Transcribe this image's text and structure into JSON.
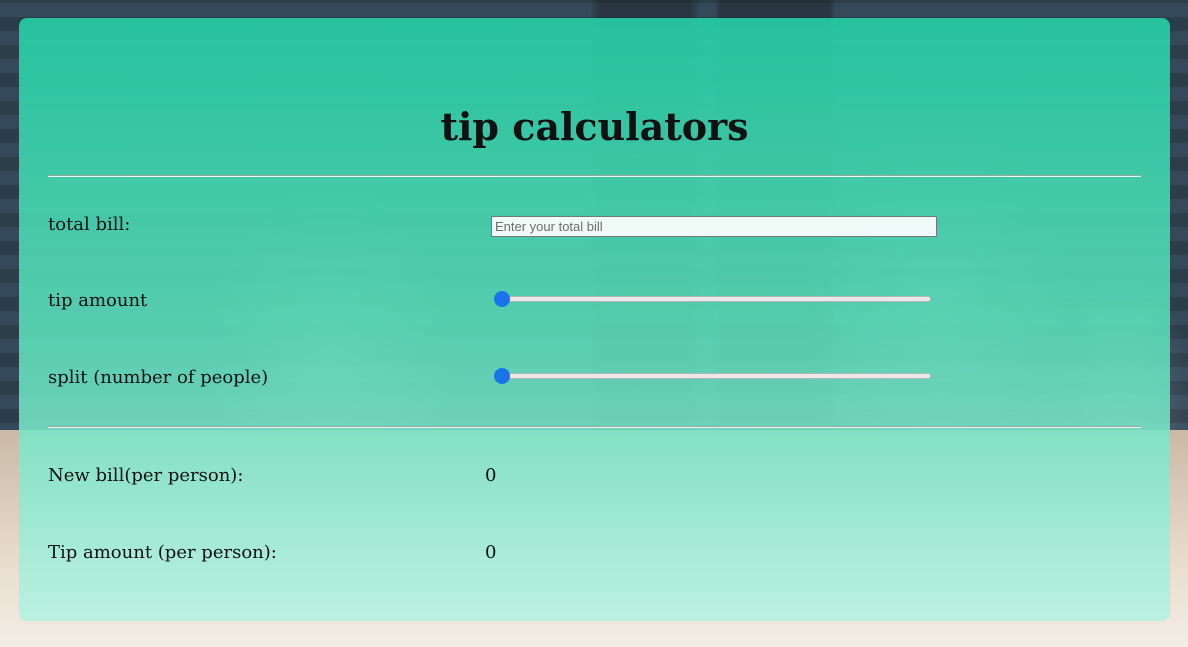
{
  "calculator": {
    "title": "tip calculators",
    "bill": {
      "label": "total bill:",
      "placeholder": "Enter your total bill",
      "value": ""
    },
    "tip": {
      "label": "tip amount",
      "level": 0
    },
    "split": {
      "label": "split (number of people)",
      "level": 0
    },
    "results": {
      "new_bill_label": "New bill(per person):",
      "new_bill_value": "0",
      "tip_per_person_label": "Tip amount (per person):",
      "tip_per_person_value": "0"
    }
  },
  "colors": {
    "accent": "#1a73e8",
    "card_top": "#25cca4",
    "card_bottom": "#b4f2e1"
  }
}
